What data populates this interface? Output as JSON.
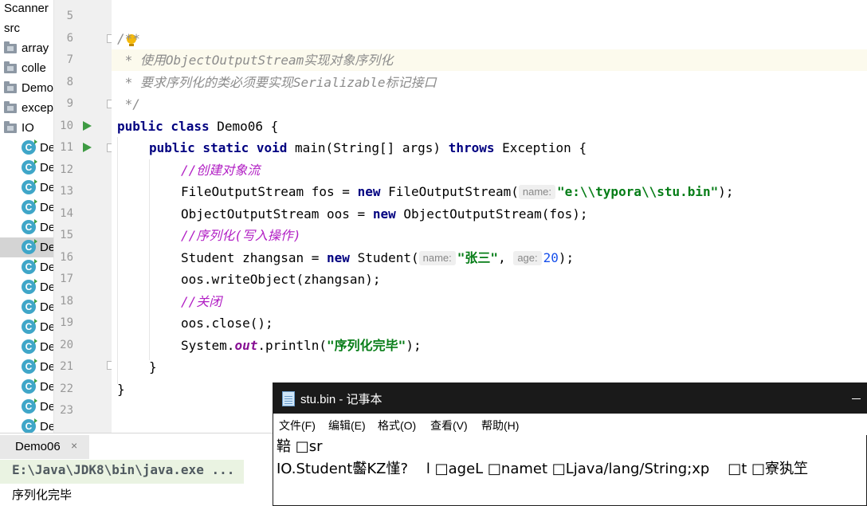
{
  "project_tree": {
    "items": [
      {
        "label": "Scanner",
        "type": "file",
        "icon": "text"
      },
      {
        "label": "src",
        "type": "file",
        "icon": "text"
      },
      {
        "label": "array",
        "type": "folder",
        "icon": "folder-icon"
      },
      {
        "label": "colle",
        "type": "folder",
        "icon": "folder-icon"
      },
      {
        "label": "Demo",
        "type": "folder",
        "icon": "folder-icon"
      },
      {
        "label": "excep",
        "type": "folder",
        "icon": "folder-icon"
      },
      {
        "label": "IO",
        "type": "folder",
        "icon": "folder-icon"
      },
      {
        "label": "De",
        "type": "class",
        "icon": "java-class-icon"
      },
      {
        "label": "De",
        "type": "class",
        "icon": "java-class-icon"
      },
      {
        "label": "De",
        "type": "class",
        "icon": "java-class-icon"
      },
      {
        "label": "De",
        "type": "class",
        "icon": "java-class-icon"
      },
      {
        "label": "De",
        "type": "class",
        "icon": "java-class-icon"
      },
      {
        "label": "De",
        "type": "class",
        "icon": "java-class-icon",
        "selected": true
      },
      {
        "label": "De",
        "type": "class",
        "icon": "java-class-icon"
      },
      {
        "label": "De",
        "type": "class",
        "icon": "java-class-icon"
      },
      {
        "label": "De",
        "type": "class",
        "icon": "java-class-icon"
      },
      {
        "label": "De",
        "type": "class",
        "icon": "java-class-icon"
      },
      {
        "label": "De",
        "type": "class",
        "icon": "java-class-icon"
      },
      {
        "label": "De",
        "type": "class",
        "icon": "java-class-icon"
      },
      {
        "label": "De",
        "type": "class",
        "icon": "java-class-icon"
      },
      {
        "label": "De",
        "type": "class",
        "icon": "java-class-icon"
      },
      {
        "label": "De",
        "type": "class",
        "icon": "java-class-icon"
      }
    ]
  },
  "editor": {
    "line_numbers": [
      "5",
      "6",
      "7",
      "8",
      "9",
      "10",
      "11",
      "12",
      "13",
      "14",
      "15",
      "16",
      "17",
      "18",
      "19",
      "20",
      "21",
      "22",
      "23"
    ],
    "current_line": "7",
    "lines": {
      "l6": "/**",
      "l7": " * 使用ObjectOutputStream实现对象序列化",
      "l8": " * 要求序列化的类必须要实现Serializable标记接口",
      "l9": " */",
      "l10_kw": "public class",
      "l10_rest": " Demo06 {",
      "l11_kw": "public static void",
      "l11_mid": " main(String[] args) ",
      "l11_kw2": "throws",
      "l11_rest": " Exception {",
      "l12": "//创建对象流",
      "l13_a": "FileOutputStream fos = ",
      "l13_kw": "new",
      "l13_b": " FileOutputStream(",
      "l13_hint": "name:",
      "l13_str": "\"e:\\\\typora\\\\stu.bin\"",
      "l13_end": ");",
      "l14_a": "ObjectOutputStream oos = ",
      "l14_kw": "new",
      "l14_b": " ObjectOutputStream(fos);",
      "l15": "//序列化(写入操作)",
      "l16_a": "Student zhangsan = ",
      "l16_kw": "new",
      "l16_b": " Student(",
      "l16_hint1": "name:",
      "l16_str": "\"张三\"",
      "l16_comma": ", ",
      "l16_hint2": "age:",
      "l16_num": "20",
      "l16_end": ");",
      "l17": "oos.writeObject(zhangsan);",
      "l18": "//关闭",
      "l19": "oos.close();",
      "l20_a": "System.",
      "l20_fld": "out",
      "l20_b": ".println(",
      "l20_str": "\"序列化完毕\"",
      "l20_end": ");",
      "l21": "}",
      "l22": "}"
    }
  },
  "run_panel": {
    "tab_label": "Demo06",
    "close_glyph": "×",
    "command": "E:\\Java\\JDK8\\bin\\java.exe ...",
    "output": "序列化完毕"
  },
  "notepad": {
    "title": "stu.bin - 记事本",
    "menu": [
      "文件(F)",
      "编辑(E)",
      "格式(O)",
      "查看(V)",
      "帮助(H)"
    ],
    "content_line1": "鞛 □sr",
    "content_line2": "IO.Student齾KZ慬?    l □ageL □namet □Ljava/lang/String;xp    □t □寮犱笁"
  },
  "colors": {
    "keyword": "#000080",
    "string": "#067d17",
    "number": "#1750eb",
    "comment": "#8c8c8c",
    "line_comment": "#b11ec4",
    "run_icon": "#3e9b43",
    "current_line_bg": "#fcfaed",
    "notepad_title_bg": "#1a1a1a"
  }
}
